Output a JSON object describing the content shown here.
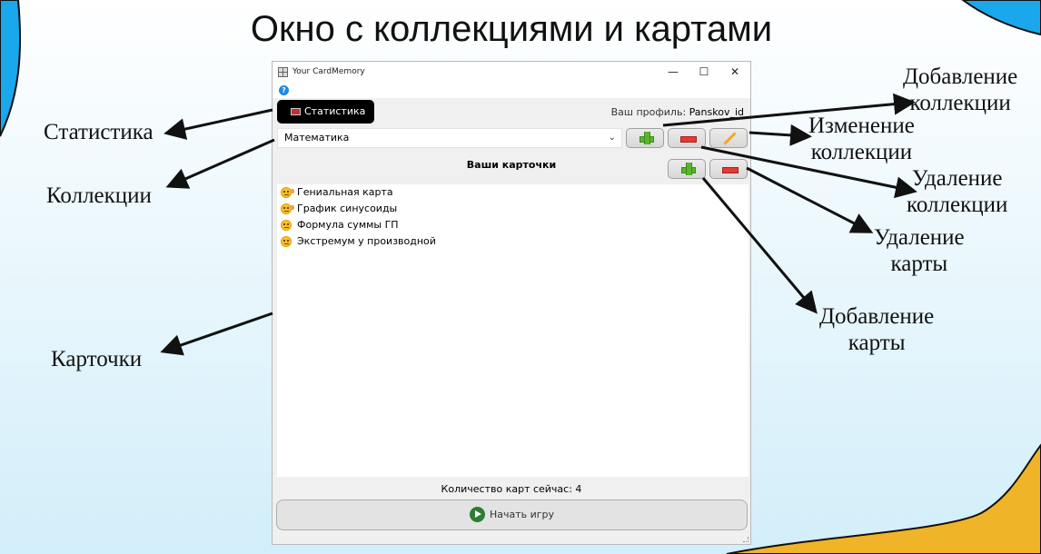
{
  "slide": {
    "title": "Окно с коллекциями и картами"
  },
  "callouts": {
    "stats": "Статистика",
    "collections": "Коллекции",
    "cards": "Карточки",
    "add_collection_1": "Добавление",
    "add_collection_2": "коллекции",
    "edit_collection_1": "Изменение",
    "edit_collection_2": "коллекции",
    "delete_collection_1": "Удаление",
    "delete_collection_2": "коллекции",
    "delete_card_1": "Удаление",
    "delete_card_2": "карты",
    "add_card_1": "Добавление",
    "add_card_2": "карты"
  },
  "window": {
    "title": "Your CardMemory",
    "minimize": "—",
    "maximize": "☐",
    "close": "✕",
    "help": "?",
    "stats_button": "Статистика",
    "profile_label": "Ваш профиль:",
    "profile_name": "Panskov_id",
    "collection_selected": "Математика",
    "cards_header": "Ваши карточки",
    "cards": [
      {
        "title": "Гениальная карта",
        "icon": "thinking-face-icon"
      },
      {
        "title": "График синусоиды",
        "icon": "thinking-face-icon"
      },
      {
        "title": "Формула суммы ГП",
        "icon": "neutral-face-icon"
      },
      {
        "title": "Экстремум у производной",
        "icon": "neutral-face-icon"
      }
    ],
    "count_text": "Количество карт сейчас: 4",
    "start_button": "Начать игру"
  },
  "colors": {
    "accent_blue": "#1aa7ec",
    "accent_yellow": "#f0b429",
    "add_green": "#59b52b",
    "delete_red": "#e53935",
    "edit_orange": "#f5a623",
    "play_green": "#2e7d32"
  }
}
